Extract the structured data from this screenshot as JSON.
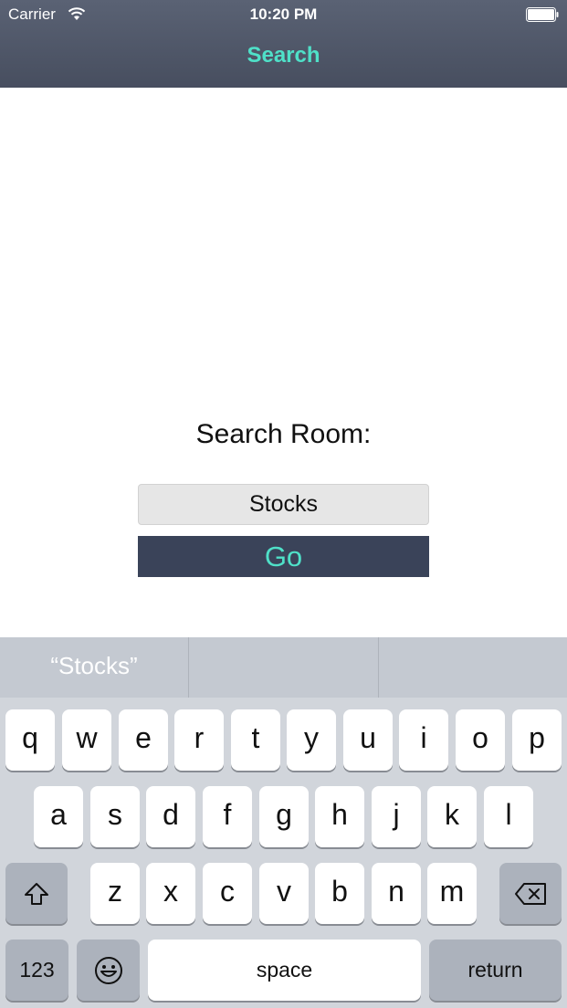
{
  "status_bar": {
    "carrier": "Carrier",
    "time": "10:20 PM"
  },
  "nav": {
    "title": "Search"
  },
  "form": {
    "label": "Search Room:",
    "input_value": "Stocks",
    "go_label": "Go"
  },
  "keyboard": {
    "predictions": [
      "“Stocks”",
      "",
      ""
    ],
    "row1": [
      "q",
      "w",
      "e",
      "r",
      "t",
      "y",
      "u",
      "i",
      "o",
      "p"
    ],
    "row2": [
      "a",
      "s",
      "d",
      "f",
      "g",
      "h",
      "j",
      "k",
      "l"
    ],
    "row3": [
      "z",
      "x",
      "c",
      "v",
      "b",
      "n",
      "m"
    ],
    "numbers_label": "123",
    "space_label": "space",
    "return_label": "return",
    "icons": {
      "shift": "shift-icon",
      "delete": "backspace-icon",
      "emoji": "emoji-icon"
    }
  },
  "colors": {
    "accent": "#4fe0c8",
    "navbar": "#505769",
    "go_button": "#3a4359",
    "input_bg": "#e6e6e6",
    "keyboard_bg": "#d1d5db"
  }
}
